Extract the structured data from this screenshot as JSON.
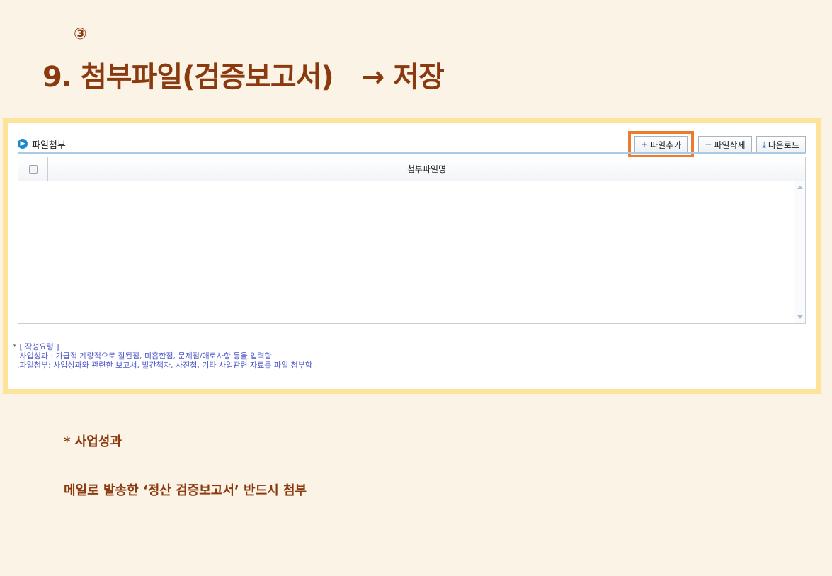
{
  "heading": {
    "step": "③",
    "title": "9. 첨부파일(검증보고서)　→ 저장"
  },
  "panel": {
    "section_title": "파일첨부",
    "toolbar": {
      "add_label": "파일추가",
      "delete_label": "파일삭제",
      "download_label": "다운로드"
    },
    "grid": {
      "column_header": "첨부파일명",
      "rows": []
    },
    "notes": {
      "heading": "[ 작성요령 ]",
      "lines": [
        ".사업성과 : 가급적 계량적으로 잘된점, 미흡한점, 문제점/애로사항 등을 입력함",
        ".파일첨부: 사업성과와 관련한 보고서, 발간책자, 사진첩, 기타 사업관련 자료를 파일 첨부함"
      ]
    }
  },
  "captions": {
    "line1": "* 사업성과",
    "line2": "메일로 발송한 ‘정산 검증보고서’ 반드시 첨부"
  },
  "colors": {
    "title": "#8b3a0f",
    "frame": "#fde49a",
    "highlight": "#ee7a2c",
    "notes_text": "#4a57c8"
  }
}
